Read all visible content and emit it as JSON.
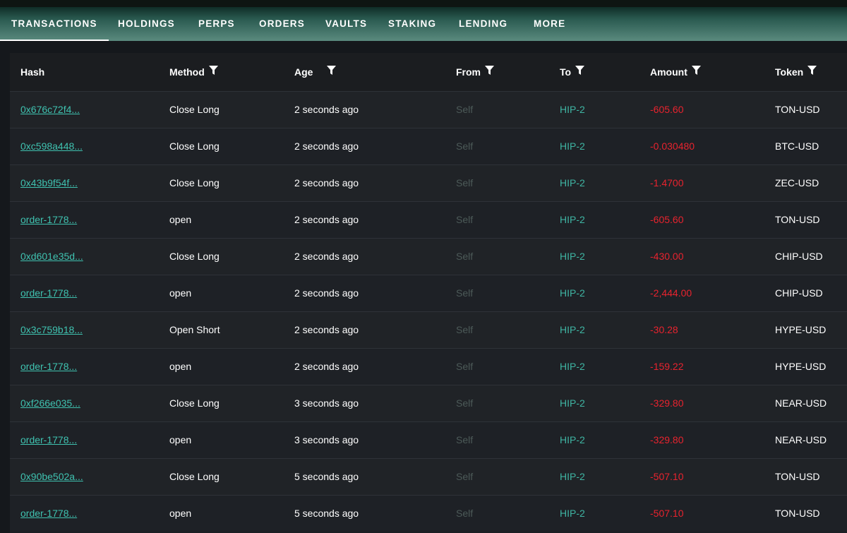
{
  "tabs": [
    {
      "label": "TRANSACTIONS",
      "active": true
    },
    {
      "label": "HOLDINGS",
      "active": false
    },
    {
      "label": "PERPS",
      "active": false
    },
    {
      "label": "ORDERS",
      "active": false
    },
    {
      "label": "VAULTS",
      "active": false
    },
    {
      "label": "STAKING",
      "active": false
    },
    {
      "label": "LENDING",
      "active": false
    },
    {
      "label": "MORE",
      "active": false
    }
  ],
  "table": {
    "columns": [
      "Hash",
      "Method",
      "Age",
      "From",
      "To",
      "Amount",
      "Token"
    ],
    "rows": [
      {
        "hash": "0x676c72f4...",
        "method": "Close Long",
        "age": "2 seconds ago",
        "from": "Self",
        "to": "HIP-2",
        "amount": "-605.60",
        "token": "TON-USD"
      },
      {
        "hash": "0xc598a448...",
        "method": "Close Long",
        "age": "2 seconds ago",
        "from": "Self",
        "to": "HIP-2",
        "amount": "-0.030480",
        "token": "BTC-USD"
      },
      {
        "hash": "0x43b9f54f...",
        "method": "Close Long",
        "age": "2 seconds ago",
        "from": "Self",
        "to": "HIP-2",
        "amount": "-1.4700",
        "token": "ZEC-USD"
      },
      {
        "hash": "order-1778...",
        "method": "open",
        "age": "2 seconds ago",
        "from": "Self",
        "to": "HIP-2",
        "amount": "-605.60",
        "token": "TON-USD"
      },
      {
        "hash": "0xd601e35d...",
        "method": "Close Long",
        "age": "2 seconds ago",
        "from": "Self",
        "to": "HIP-2",
        "amount": "-430.00",
        "token": "CHIP-USD"
      },
      {
        "hash": "order-1778...",
        "method": "open",
        "age": "2 seconds ago",
        "from": "Self",
        "to": "HIP-2",
        "amount": "-2,444.00",
        "token": "CHIP-USD"
      },
      {
        "hash": "0x3c759b18...",
        "method": "Open Short",
        "age": "2 seconds ago",
        "from": "Self",
        "to": "HIP-2",
        "amount": "-30.28",
        "token": "HYPE-USD"
      },
      {
        "hash": "order-1778...",
        "method": "open",
        "age": "2 seconds ago",
        "from": "Self",
        "to": "HIP-2",
        "amount": "-159.22",
        "token": "HYPE-USD"
      },
      {
        "hash": "0xf266e035...",
        "method": "Close Long",
        "age": "3 seconds ago",
        "from": "Self",
        "to": "HIP-2",
        "amount": "-329.80",
        "token": "NEAR-USD"
      },
      {
        "hash": "order-1778...",
        "method": "open",
        "age": "3 seconds ago",
        "from": "Self",
        "to": "HIP-2",
        "amount": "-329.80",
        "token": "NEAR-USD"
      },
      {
        "hash": "0x90be502a...",
        "method": "Close Long",
        "age": "5 seconds ago",
        "from": "Self",
        "to": "HIP-2",
        "amount": "-507.10",
        "token": "TON-USD"
      },
      {
        "hash": "order-1778...",
        "method": "open",
        "age": "5 seconds ago",
        "from": "Self",
        "to": "HIP-2",
        "amount": "-507.10",
        "token": "TON-USD"
      }
    ]
  },
  "colors": {
    "link": "#3fc2b0",
    "to": "#3fb5a3",
    "amount_negative": "#e8232e",
    "from_muted": "#4c5a58"
  },
  "icons": {
    "filter": "filter-icon"
  }
}
